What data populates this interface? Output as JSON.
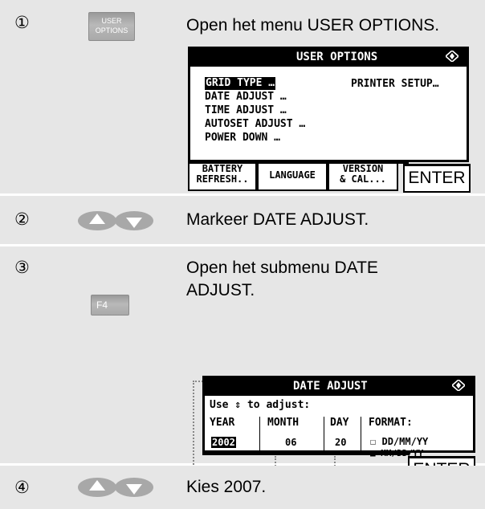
{
  "steps": [
    {
      "number": "①",
      "key": "USER OPTIONS",
      "key_lines": [
        "USER",
        "OPTIONS"
      ],
      "text": "Open het menu USER OPTIONS.",
      "screen": {
        "title": "USER OPTIONS",
        "indicator": "◇",
        "items": [
          "GRID TYPE …",
          "DATE ADJUST …",
          "TIME ADJUST …",
          "AUTOSET ADJUST …",
          "POWER DOWN …"
        ],
        "selected_item": "GRID TYPE …",
        "right_item": "PRINTER  SETUP…",
        "softkeys": [
          "BATTERY REFRESH..",
          "LANGUAGE",
          "VERSION & CAL...",
          "ENTER"
        ],
        "softkey_lines": [
          [
            "BATTERY",
            "REFRESH.."
          ],
          [
            "LANGUAGE"
          ],
          [
            "VERSION",
            "& CAL..."
          ],
          [
            "ENTER"
          ]
        ]
      }
    },
    {
      "number": "②",
      "key": "up-down-arrows",
      "text": "Markeer DATE ADJUST."
    },
    {
      "number": "③",
      "key": "F4",
      "text_lines": [
        "Open het submenu DATE",
        "ADJUST."
      ],
      "screen": {
        "title": "DATE ADJUST",
        "indicator": "◇",
        "instruction": "Use ⇕ to adjust:",
        "columns": [
          "YEAR",
          "MONTH",
          "DAY",
          "FORMAT:"
        ],
        "values": {
          "year": "2002",
          "month": "06",
          "day": "20"
        },
        "selected_value": "2002",
        "formats": [
          {
            "label": "DD/MM/YY",
            "checked": false
          },
          {
            "label": "MM/DD/YY",
            "checked": true
          }
        ],
        "softkey": "ENTER"
      }
    },
    {
      "number": "④",
      "key": "up-down-arrows",
      "text": "Kies 2007."
    }
  ],
  "colors": {
    "row_background": "#e6e6e6",
    "key_gray": "#b0b0b0",
    "arrow_gray": "#a8a8a8"
  },
  "checkbox": {
    "unchecked": "☐",
    "checked": "■"
  }
}
